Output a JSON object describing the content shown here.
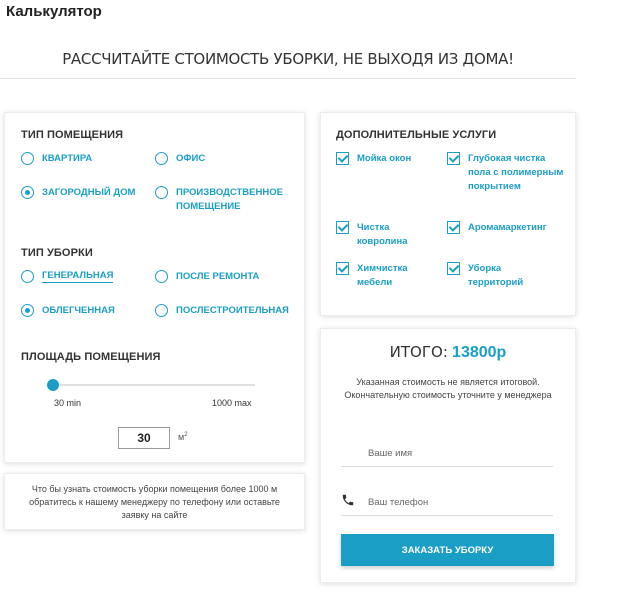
{
  "page": {
    "title": "Калькулятор"
  },
  "hero": {
    "heading": "РАССЧИТАЙТЕ СТОИМОСТЬ УБОРКИ, НЕ ВЫХОДЯ ИЗ ДОМА!"
  },
  "premises": {
    "title": "ТИП ПОМЕЩЕНИЯ",
    "options": [
      {
        "label": "КВАРТИРА",
        "checked": false
      },
      {
        "label": "ОФИС",
        "checked": false
      },
      {
        "label": "ЗАГОРОДНЫЙ ДОМ",
        "checked": true
      },
      {
        "label": "ПРОИЗВОДСТВЕННОЕ ПОМЕЩЕНИЕ",
        "checked": false
      }
    ]
  },
  "cleaning": {
    "title": "ТИП УБОРКИ",
    "options": [
      {
        "label": "ГЕНЕРАЛЬНАЯ",
        "checked": false
      },
      {
        "label": "ПОСЛЕ РЕМОНТА",
        "checked": false
      },
      {
        "label": "ОБЛЕГЧЕННАЯ",
        "checked": true
      },
      {
        "label": "ПОСЛЕСТРОИТЕЛЬНАЯ",
        "checked": false
      }
    ]
  },
  "area": {
    "title": "ПЛОЩАДЬ ПОМЕЩЕНИЯ",
    "min_label": "30 min",
    "max_label": "1000 max",
    "value": "30",
    "unit": "м",
    "unit_power": "2"
  },
  "note": {
    "text": "Что бы узнать стоимость уборки помещения более 1000 м обратитесь к нашему менеджеру по телефону или оставьте заявку на сайте"
  },
  "extras": {
    "title": "ДОПОЛНИТЕЛЬНЫЕ УСЛУГИ",
    "items": [
      {
        "label": "Мойка окон",
        "checked": true
      },
      {
        "label": "Глубокая чистка пола с полимерным покрытием",
        "checked": true
      },
      {
        "label": "Чистка ковролина",
        "checked": true
      },
      {
        "label": "Аромамаркетинг",
        "checked": true
      },
      {
        "label": "Химчистка мебели",
        "checked": true
      },
      {
        "label": "Уборка территорий",
        "checked": true
      }
    ]
  },
  "order": {
    "total_label": "ИТОГО:",
    "total_value": "13800р",
    "disclaimer": "Указанная стоимость не является итоговой. Окончательную стоимость уточните у менеджера",
    "name_placeholder": "Ваше имя",
    "phone_placeholder": "Ваш телефон",
    "phone_icon": "phone-icon",
    "submit_label": "ЗАКАЗАТЬ УБОРКУ"
  },
  "colors": {
    "accent": "#1b9ec6"
  }
}
